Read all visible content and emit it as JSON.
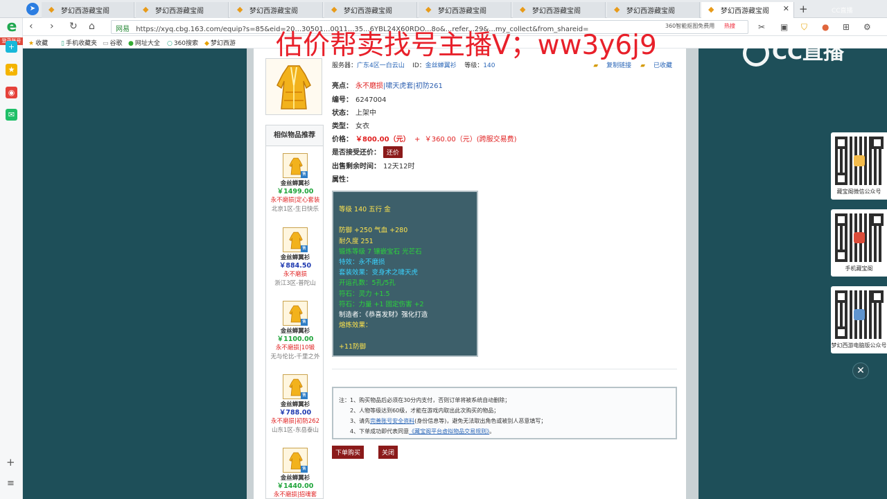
{
  "browser": {
    "tabs": [
      {
        "title": "梦幻西游藏宝阁",
        "active": false
      },
      {
        "title": "梦幻西游藏宝阁",
        "active": false
      },
      {
        "title": "梦幻西游藏宝阁",
        "active": false
      },
      {
        "title": "梦幻西游藏宝阁",
        "active": false
      },
      {
        "title": "梦幻西游藏宝阁",
        "active": false
      },
      {
        "title": "梦幻西游藏宝阁",
        "active": false
      },
      {
        "title": "梦幻西游藏宝阁",
        "active": false
      },
      {
        "title": "梦幻西游藏宝阁",
        "active": true
      }
    ],
    "url_site": "网易",
    "url": "https://xyq.cbg.163.com/equip?s=85&eid=20...30501...0011...35...6YBL24X60RDO...8o&...refer...29&...my_collect&from_shareid=",
    "search_hint": "360智能抠图免费用",
    "hot_label": "热搜",
    "bookmarks": [
      "收藏",
      "手机收藏夹",
      "谷歌",
      "网址大全",
      "360搜索",
      "梦幻西游"
    ]
  },
  "sidebar": {
    "login_label": "登录账号"
  },
  "overlay": {
    "promo_text": "估价帮卖找号主播V；ww3y6j9",
    "cc_logo": "CC直播",
    "cc_mini": "CC直播"
  },
  "item": {
    "server_label": "服务器：",
    "server_value": "广东4区一白云山",
    "id_label": "ID：",
    "id_value": "金丝蝉翼衫",
    "level_label": "等级：",
    "level_value": "140",
    "copy_link": "复制链接",
    "collected": "已收藏",
    "highlight_label": "亮点：",
    "highlights": [
      "永不磨损",
      "啸天虎套",
      "初防261"
    ],
    "number_label": "编号：",
    "number_value": "6247004",
    "status_label": "状态：",
    "status_value": "上架中",
    "type_label": "类型：",
    "type_value": "女衣",
    "price_label": "价格：",
    "price_value": "￥800.00（元）",
    "price_plus": "+",
    "price_fee": "￥360.00（元）(跨服交易费)",
    "counter_label": "是否接受还价：",
    "counter_button": "还价",
    "remaining_label": "出售剩余时间：",
    "remaining_value": "12天12时",
    "attr_label": "属性："
  },
  "attributes": {
    "line1": "等级 140  五行 金",
    "line2": "防御 +250  气血 +280",
    "line3": "耐久度 251",
    "line4": "锻炼等级 7  镶嵌宝石 光芒石",
    "line5": "特效：永不磨损",
    "line6": "套装效果：变身术之啸天虎",
    "line7": "开运孔数：5孔/5孔",
    "line8": "符石：灵力 +1.5",
    "line9": "符石：力量 +1 固定伤害 +2",
    "line10": "制造者：《恭喜发财》强化打造",
    "line11": "熔炼效果：",
    "line12": "+11防御"
  },
  "notice": {
    "l1": "注：1、购买物品后必须在30分内支付，否则订单将被系统自动删除；",
    "l2": "2、人物等级达到60级，才能在游戏内取出此次购买的物品；",
    "l3a": "3、请先",
    "l3link": "完善账号安全资料",
    "l3b": "(身份信息等)，避免无法取出角色或被别人恶意填写；",
    "l4a": "4、下单成功即代表同意",
    "l4link": "《藏宝阁平台虚拟物品交易规则》",
    "l4b": "。"
  },
  "buttons": {
    "buy": "下单购买",
    "close": "关闭"
  },
  "similar": {
    "title": "相似物品推荐",
    "badge": "售",
    "items": [
      {
        "name": "金丝蝉翼衫",
        "price": "￥1499.00",
        "highlight": "永不磨损|定心套装",
        "server": "北京1区-生日快乐",
        "color": "green"
      },
      {
        "name": "金丝蝉翼衫",
        "price": "￥884.50",
        "highlight": "永不磨损",
        "server": "浙江3区-普陀山",
        "color": "blue"
      },
      {
        "name": "金丝蝉翼衫",
        "price": "￥1100.00",
        "highlight": "永不磨损|10锻",
        "server": "无与伦比-千里之外",
        "color": "green"
      },
      {
        "name": "金丝蝉翼衫",
        "price": "￥788.00",
        "highlight": "永不磨损|初防262",
        "server": "山东1区-东岳泰山",
        "color": "blue"
      },
      {
        "name": "金丝蝉翼衫",
        "price": "￥1440.00",
        "highlight": "永不磨损|招魂套",
        "server": "",
        "color": "green"
      }
    ]
  },
  "qr_cards": [
    {
      "caption": "藏宝阁微信公众号",
      "accent": "#f2b233"
    },
    {
      "caption": "手机藏宝阁",
      "accent": "#d8341f"
    },
    {
      "caption": "梦幻西游电脑版公众号",
      "accent": "#4a86c8"
    }
  ],
  "colors": {
    "page_bg": "#1d4b55",
    "price_red": "#e02020",
    "link_blue": "#2a66b7",
    "button_dark_red": "#8b1a1a",
    "attr_box_bg": "#3d5f6a"
  }
}
